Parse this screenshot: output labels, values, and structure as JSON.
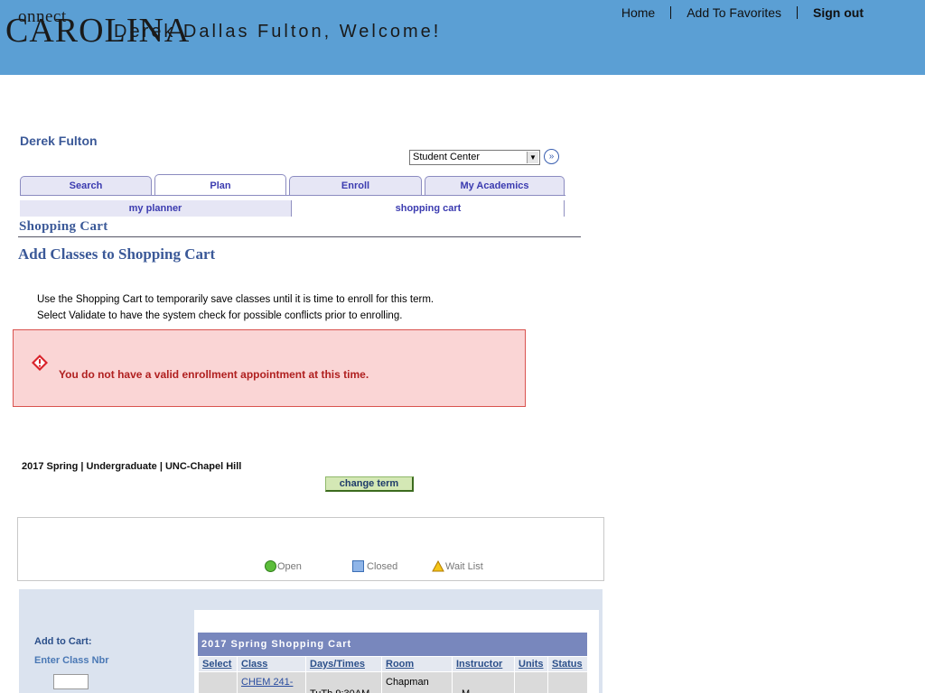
{
  "header": {
    "logo_small": "onnect",
    "logo_big": "CAROLINA",
    "welcome": "Derek Dallas Fulton, Welcome!",
    "links": [
      "Home",
      "Add To Favorites",
      "Sign out"
    ]
  },
  "user": {
    "name": "Derek Fulton"
  },
  "navigation": {
    "selected": "Student Center"
  },
  "tabs": [
    "Search",
    "Plan",
    "Enroll",
    "My Academics"
  ],
  "active_tab": "Plan",
  "subtabs": [
    "my planner",
    "shopping cart"
  ],
  "page": {
    "title": "Shopping Cart",
    "subtitle": "Add Classes to Shopping Cart",
    "instructions": [
      "Use the Shopping Cart to temporarily save classes until it is time to enroll for this term.",
      "Select Validate to have the system check for possible conflicts prior to enrolling."
    ]
  },
  "error": {
    "message": "You do not have a valid enrollment appointment at this time."
  },
  "term": {
    "text": "2017 Spring | Undergraduate | UNC-Chapel Hill",
    "change_label": "change term"
  },
  "legend": [
    "Open",
    "Closed",
    "Wait List"
  ],
  "add_to_cart": {
    "label": "Add to Cart:",
    "enter_label": "Enter Class Nbr",
    "value": ""
  },
  "cart": {
    "title": "2017 Spring Shopping Cart",
    "columns": [
      "Select",
      "Class",
      "Days/Times",
      "Room",
      "Instructor",
      "Units",
      "Status"
    ],
    "rows": [
      {
        "class": "CHEM 241-",
        "days_times": "TuTh 9:30AM",
        "room": "Chapman",
        "instructor": "M"
      }
    ]
  },
  "colors": {
    "header_bg": "#5b9fd4",
    "accent": "#3b5998",
    "error_bg": "#fad5d5",
    "error_text": "#b02020"
  }
}
